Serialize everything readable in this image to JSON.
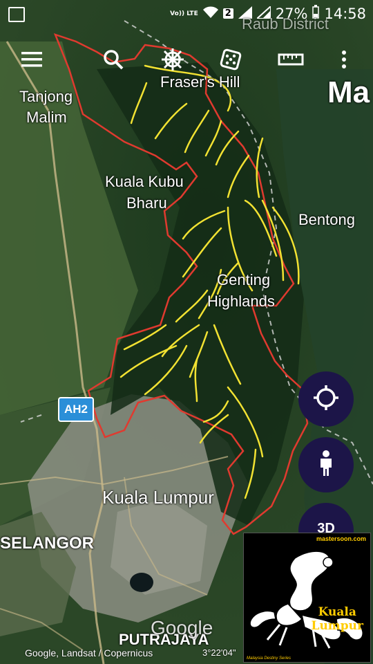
{
  "status_bar": {
    "network": "Vo)) LTE",
    "sim": "2",
    "battery": "27%",
    "time": "14:58"
  },
  "toolbar": {
    "menu_icon": "menu-icon",
    "search_icon": "search-icon",
    "wheel_icon": "ship-wheel-icon",
    "dice_icon": "dice-icon",
    "ruler_icon": "ruler-icon",
    "more_icon": "more-vert-icon"
  },
  "map_labels": {
    "raub": "Raub District",
    "frasers_hill": "Fraser's Hill",
    "state_partial": "Ma",
    "tanjong": "Tanjong",
    "malim": "Malim",
    "kuala_kubu": "Kuala Kubu",
    "bharu": "Bharu",
    "bentong": "Bentong",
    "genting": "Genting",
    "highlands": "Highlands",
    "kuala_lumpur": "Kuala Lumpur",
    "selangor": "SELANGOR",
    "putrajaya": "PUTRAJAYA"
  },
  "route_badge": "AH2",
  "fab": {
    "location_icon": "crosshair-icon",
    "person_icon": "person-icon",
    "three_d_label": "3D"
  },
  "overlay_logo": {
    "url": "mastersoon.com",
    "title_line1": "Kuala",
    "title_line2": "Lumpur",
    "series": "Malaysia Destiny Series",
    "icon": "scorpion-icon"
  },
  "footer": {
    "attribution": "Google, Landsat / Copernicus",
    "coordinates": "3°22'04\"",
    "watermark": "Google"
  },
  "colors": {
    "boundary": "#e03a2f",
    "ridge_lines": "#f2e232",
    "fab_bg": "#1c1548",
    "route_badge": "#2b8fd8"
  }
}
